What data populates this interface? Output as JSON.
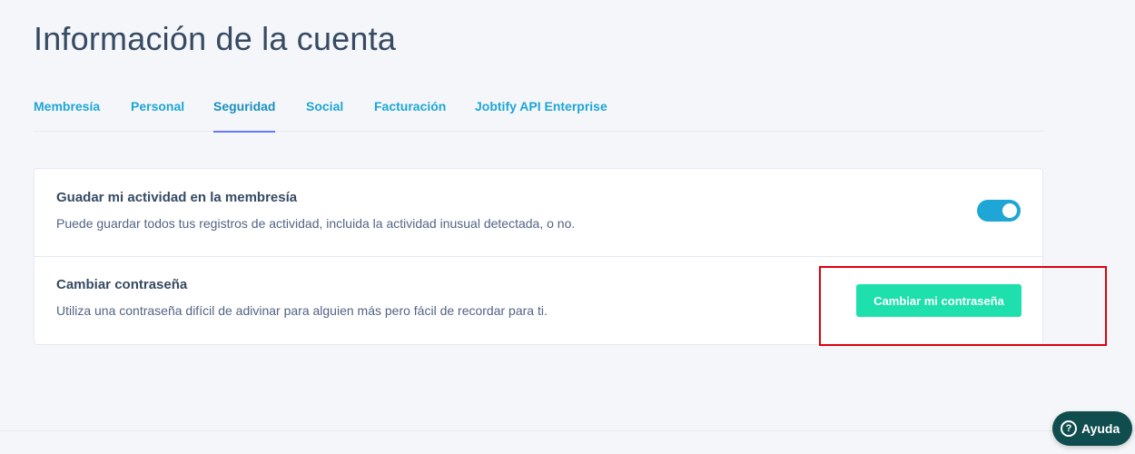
{
  "page": {
    "title": "Información de la cuenta"
  },
  "tabs": [
    {
      "label": "Membresía"
    },
    {
      "label": "Personal"
    },
    {
      "label": "Seguridad",
      "active": true
    },
    {
      "label": "Social"
    },
    {
      "label": "Facturación"
    },
    {
      "label": "Jobtify API Enterprise"
    }
  ],
  "security": {
    "activity": {
      "title": "Guadar mi actividad en la membresía",
      "description": "Puede guardar todos tus registros de actividad, incluida la actividad inusual detectada, o no.",
      "enabled": true
    },
    "password": {
      "title": "Cambiar contraseña",
      "description": "Utiliza una contraseña difícil de adivinar para alguien más pero fácil de recordar para ti.",
      "button_label": "Cambiar mi contraseña"
    }
  },
  "help": {
    "icon": "question-circle-icon",
    "label": "Ayuda"
  },
  "colors": {
    "accent": "#1ea6d6",
    "active_tab_underline": "#6576ff",
    "primary_button": "#1ee0ac",
    "highlight": "#e0000c",
    "help_button": "#0f4d4e"
  }
}
